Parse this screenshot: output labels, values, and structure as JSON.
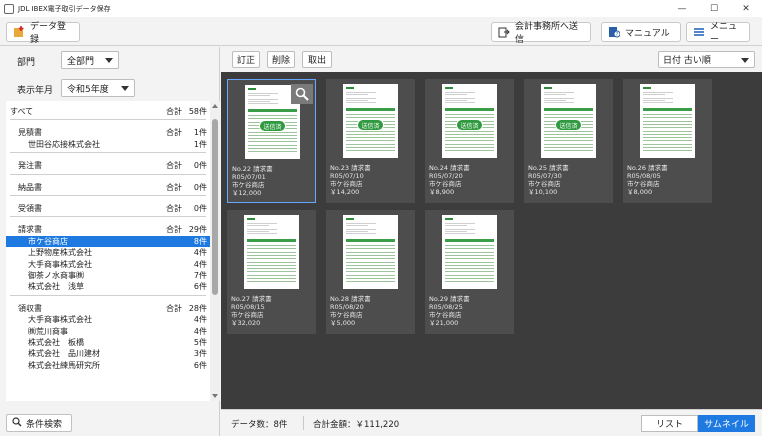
{
  "window": {
    "title": "JDL IBEX電子取引データ保存",
    "min": "—",
    "max": "☐",
    "close": "✕"
  },
  "toolbar": {
    "data_register": "データ登録",
    "send_accounting": "会計事務所へ送信",
    "manual": "マニュアル",
    "menu": "メニュー"
  },
  "filters": {
    "dept_label": "部門",
    "dept_value": "全部門",
    "period_label": "表示年月",
    "period_value": "令和5年度"
  },
  "tree": {
    "total_label": "合計",
    "all": {
      "name": "すべて",
      "count": "58件"
    },
    "groups": [
      {
        "name": "見積書",
        "count": "1件",
        "items": [
          {
            "name": "世田谷応接株式会社",
            "count": "1件"
          }
        ]
      },
      {
        "name": "発注書",
        "count": "0件",
        "items": []
      },
      {
        "name": "納品書",
        "count": "0件",
        "items": []
      },
      {
        "name": "受領書",
        "count": "0件",
        "items": []
      },
      {
        "name": "請求書",
        "count": "29件",
        "items": [
          {
            "name": "市ケ谷商店",
            "count": "8件"
          },
          {
            "name": "上野物産株式会社",
            "count": "4件"
          },
          {
            "name": "大手商事株式会社",
            "count": "4件"
          },
          {
            "name": "御茶ノ水商事㈱",
            "count": "7件"
          },
          {
            "name": "株式会社　浅草",
            "count": "6件"
          }
        ]
      },
      {
        "name": "領収書",
        "count": "28件",
        "items": [
          {
            "name": "大手商事株式会社",
            "count": "4件"
          },
          {
            "name": "㈱荒川商事",
            "count": "4件"
          },
          {
            "name": "株式会社　板橋",
            "count": "5件"
          },
          {
            "name": "株式会社　品川建材",
            "count": "3件"
          },
          {
            "name": "株式会社練馬研究所",
            "count": "6件"
          }
        ]
      }
    ]
  },
  "search_button": "条件検索",
  "actions": {
    "correct": "訂正",
    "delete": "削除",
    "extract": "取出"
  },
  "sort": {
    "value": "日付 古い順"
  },
  "stamp_label": "送信済",
  "cards": [
    {
      "title": "No.22 請求書",
      "date": "R05/07/01",
      "vendor": "市ケ谷商店",
      "amount": "￥12,000",
      "sent": true,
      "selected": true
    },
    {
      "title": "No.23 請求書",
      "date": "R05/07/10",
      "vendor": "市ケ谷商店",
      "amount": "￥14,200",
      "sent": true,
      "selected": false
    },
    {
      "title": "No.24 請求書",
      "date": "R05/07/20",
      "vendor": "市ケ谷商店",
      "amount": "￥8,900",
      "sent": true,
      "selected": false
    },
    {
      "title": "No.25 請求書",
      "date": "R05/07/30",
      "vendor": "市ケ谷商店",
      "amount": "￥10,100",
      "sent": true,
      "selected": false
    },
    {
      "title": "No.26 請求書",
      "date": "R05/08/05",
      "vendor": "市ケ谷商店",
      "amount": "￥8,000",
      "sent": false,
      "selected": false
    },
    {
      "title": "No.27 請求書",
      "date": "R05/08/15",
      "vendor": "市ケ谷商店",
      "amount": "￥32,020",
      "sent": false,
      "selected": false
    },
    {
      "title": "No.28 請求書",
      "date": "R05/08/20",
      "vendor": "市ケ谷商店",
      "amount": "￥5,000",
      "sent": false,
      "selected": false
    },
    {
      "title": "No.29 請求書",
      "date": "R05/08/25",
      "vendor": "市ケ谷商店",
      "amount": "￥21,000",
      "sent": false,
      "selected": false
    }
  ],
  "status": {
    "count_label": "データ数：8件",
    "total_label": "合計金額：￥111,220",
    "view_list": "リスト",
    "view_thumb": "サムネイル"
  },
  "colors": {
    "accent": "#1e7ae0",
    "stamp": "#2f9a40",
    "dark_bg": "#3c3c3c"
  }
}
